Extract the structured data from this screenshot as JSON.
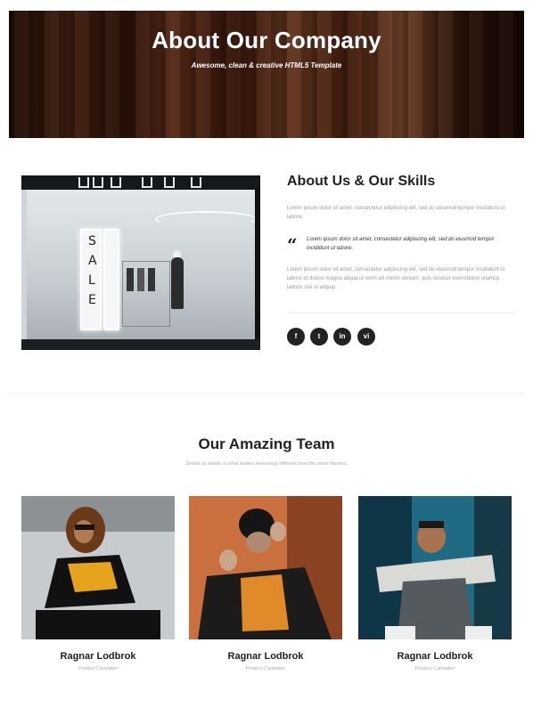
{
  "hero": {
    "title": "About Our Company",
    "subtitle": "Awesome, clean & creative HTML5 Template"
  },
  "about": {
    "heading": "About Us & Our Skills",
    "paragraph1": "Lorem ipsum dolor sit amet, consectetur adipiscing elit, sed do eiusmod tempor incididunt ut labore.",
    "quote": "Lorem ipsum dolor sit amet, consectetur adipiscing elit, sed do eiusmod tempor incididunt ut labore.",
    "paragraph2": "Lorem ipsum dolor sit amet, consectetur adipiscing elit, sed do eiusmod tempor incididunt ut labore et dolore magna aliqua ut enim ad minim veniam, quis nostrud exercitation ullamco laboris nisi ut aliquip.",
    "shop_sign": "SALE",
    "social": [
      {
        "icon": "facebook-icon",
        "glyph": "f"
      },
      {
        "icon": "twitter-icon",
        "glyph": "t"
      },
      {
        "icon": "linkedin-icon",
        "glyph": "in"
      },
      {
        "icon": "vimeo-icon",
        "glyph": "vi"
      }
    ]
  },
  "team": {
    "title": "Our Amazing Team",
    "subtitle": "Details to details is what makes Hexashop different from the other themes.",
    "members": [
      {
        "name": "Ragnar Lodbrok",
        "role": "Product Caretaker"
      },
      {
        "name": "Ragnar Lodbrok",
        "role": "Product Caretaker"
      },
      {
        "name": "Ragnar Lodbrok",
        "role": "Product Caretaker"
      }
    ]
  },
  "colors": {
    "text": "#222222",
    "muted": "#9a9a9a",
    "social_bg": "#222222"
  }
}
